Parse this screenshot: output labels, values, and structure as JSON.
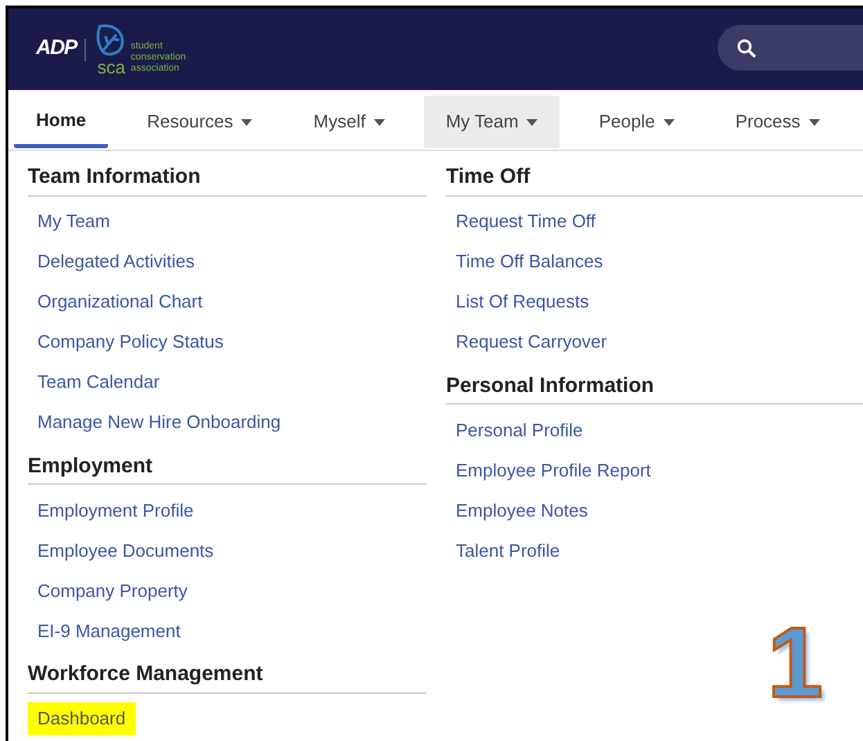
{
  "header": {
    "logo_left": "ADP",
    "logo_mark": "sca",
    "logo_text": [
      "student",
      "conservation",
      "association"
    ]
  },
  "nav": [
    {
      "label": "Home",
      "selected": true,
      "dropdown": false,
      "open": false
    },
    {
      "label": "Resources",
      "selected": false,
      "dropdown": true,
      "open": false
    },
    {
      "label": "Myself",
      "selected": false,
      "dropdown": true,
      "open": false
    },
    {
      "label": "My Team",
      "selected": false,
      "dropdown": true,
      "open": true
    },
    {
      "label": "People",
      "selected": false,
      "dropdown": true,
      "open": false
    },
    {
      "label": "Process",
      "selected": false,
      "dropdown": true,
      "open": false
    }
  ],
  "menu_columns": [
    [
      {
        "heading": "Team Information",
        "items": [
          {
            "label": "My Team",
            "highlighted": false
          },
          {
            "label": "Delegated Activities",
            "highlighted": false
          },
          {
            "label": "Organizational Chart",
            "highlighted": false
          },
          {
            "label": "Company Policy Status",
            "highlighted": false
          },
          {
            "label": "Team Calendar",
            "highlighted": false
          },
          {
            "label": "Manage New Hire Onboarding",
            "highlighted": false
          }
        ]
      },
      {
        "heading": "Employment",
        "items": [
          {
            "label": "Employment Profile",
            "highlighted": false
          },
          {
            "label": "Employee Documents",
            "highlighted": false
          },
          {
            "label": "Company Property",
            "highlighted": false
          },
          {
            "label": "EI-9 Management",
            "highlighted": false
          }
        ]
      },
      {
        "heading": "Workforce Management",
        "items": [
          {
            "label": "Dashboard",
            "highlighted": true
          }
        ]
      }
    ],
    [
      {
        "heading": "Time Off",
        "items": [
          {
            "label": "Request Time Off",
            "highlighted": false
          },
          {
            "label": "Time Off Balances",
            "highlighted": false
          },
          {
            "label": "List Of Requests",
            "highlighted": false
          },
          {
            "label": "Request Carryover",
            "highlighted": false
          }
        ]
      },
      {
        "heading": "Personal Information",
        "items": [
          {
            "label": "Personal Profile",
            "highlighted": false
          },
          {
            "label": "Employee Profile Report",
            "highlighted": false
          },
          {
            "label": "Employee Notes",
            "highlighted": false
          },
          {
            "label": "Talent Profile",
            "highlighted": false
          }
        ]
      }
    ]
  ],
  "annotation": "1"
}
